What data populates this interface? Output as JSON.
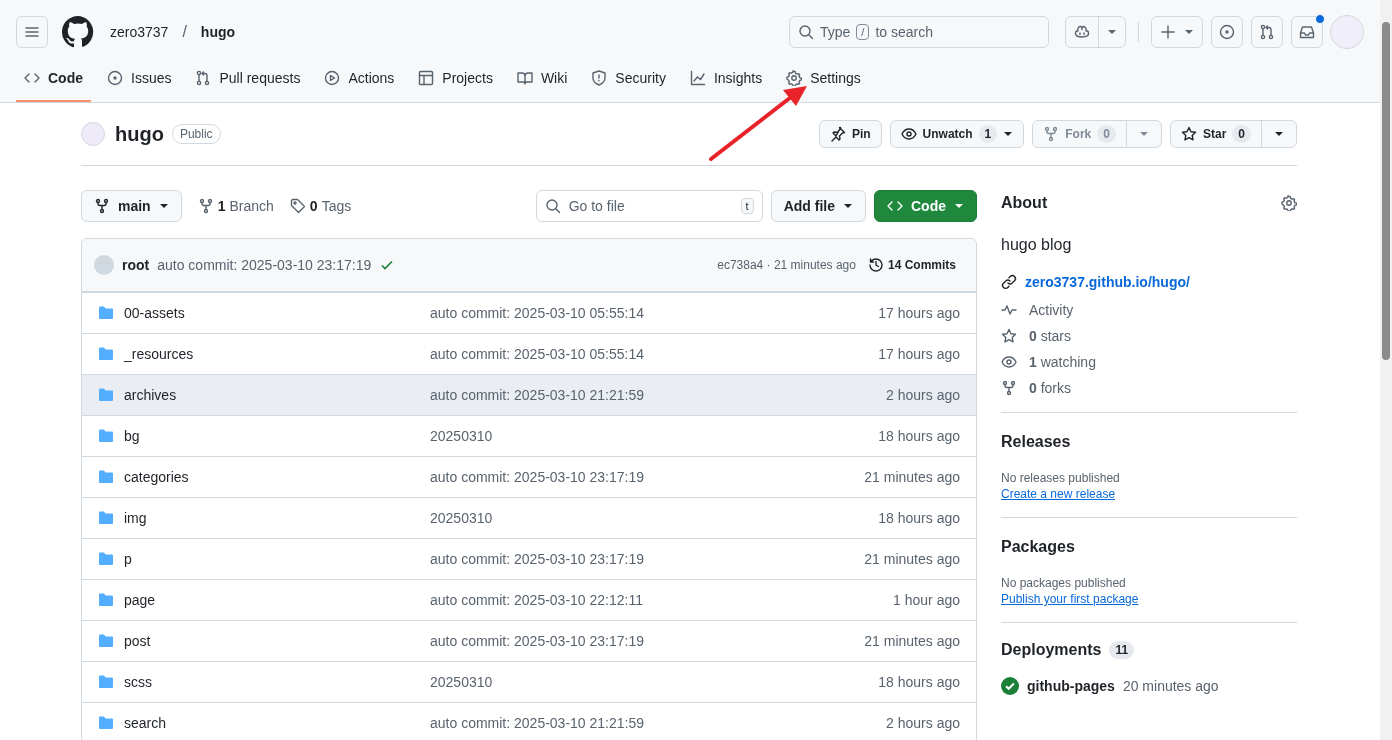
{
  "header": {
    "owner": "zero3737",
    "separator": "/",
    "repo": "hugo",
    "search": {
      "placeholder_before": "Type",
      "key": "/",
      "placeholder_after": "to search"
    },
    "notification_dot": true
  },
  "tabs": [
    {
      "label": "Code",
      "selected": true
    },
    {
      "label": "Issues",
      "selected": false
    },
    {
      "label": "Pull requests",
      "selected": false
    },
    {
      "label": "Actions",
      "selected": false
    },
    {
      "label": "Projects",
      "selected": false
    },
    {
      "label": "Wiki",
      "selected": false
    },
    {
      "label": "Security",
      "selected": false
    },
    {
      "label": "Insights",
      "selected": false
    },
    {
      "label": "Settings",
      "selected": false
    }
  ],
  "repo": {
    "name": "hugo",
    "visibility": "Public",
    "actions": [
      {
        "label": "Pin",
        "disabled": false
      },
      {
        "label": "Unwatch",
        "count": "1",
        "disabled": false
      },
      {
        "label": "Fork",
        "count": "0",
        "disabled": true
      },
      {
        "label": "Star",
        "count": "0",
        "disabled": false
      }
    ]
  },
  "toolbar": {
    "branch": "main",
    "branches": {
      "count": "1",
      "label": "Branch"
    },
    "tags": {
      "count": "0",
      "label": "Tags"
    },
    "go_to_file": {
      "placeholder": "Go to file",
      "key": "t"
    },
    "add_file": "Add file",
    "code": "Code"
  },
  "latest_commit": {
    "author": "root",
    "message": "auto commit: 2025-03-10 23:17:19",
    "hash_time": "ec738a4 · 21 minutes ago",
    "commits": "14 Commits"
  },
  "files": [
    {
      "name": "00-assets",
      "message": "auto commit: 2025-03-10 05:55:14",
      "time": "17 hours ago",
      "hovered": false
    },
    {
      "name": "_resources",
      "message": "auto commit: 2025-03-10 05:55:14",
      "time": "17 hours ago",
      "hovered": false
    },
    {
      "name": "archives",
      "message": "auto commit: 2025-03-10 21:21:59",
      "time": "2 hours ago",
      "hovered": true
    },
    {
      "name": "bg",
      "message": "20250310",
      "time": "18 hours ago",
      "hovered": false
    },
    {
      "name": "categories",
      "message": "auto commit: 2025-03-10 23:17:19",
      "time": "21 minutes ago",
      "hovered": false
    },
    {
      "name": "img",
      "message": "20250310",
      "time": "18 hours ago",
      "hovered": false
    },
    {
      "name": "p",
      "message": "auto commit: 2025-03-10 23:17:19",
      "time": "21 minutes ago",
      "hovered": false
    },
    {
      "name": "page",
      "message": "auto commit: 2025-03-10 22:12:11",
      "time": "1 hour ago",
      "hovered": false
    },
    {
      "name": "post",
      "message": "auto commit: 2025-03-10 23:17:19",
      "time": "21 minutes ago",
      "hovered": false
    },
    {
      "name": "scss",
      "message": "20250310",
      "time": "18 hours ago",
      "hovered": false
    },
    {
      "name": "search",
      "message": "auto commit: 2025-03-10 21:21:59",
      "time": "2 hours ago",
      "hovered": false
    }
  ],
  "about": {
    "title": "About",
    "description": "hugo blog",
    "website": "zero3737.github.io/hugo/",
    "stats": [
      "Activity",
      "**0** stars",
      "**1** watching",
      "**0** forks"
    ]
  },
  "releases": {
    "title": "Releases",
    "note": "No releases published",
    "link": "Create a new release"
  },
  "packages": {
    "title": "Packages",
    "note": "No packages published",
    "link": "Publish your first package"
  },
  "deployments": {
    "title": "Deployments",
    "count": "11",
    "items": [
      {
        "name": "github-pages",
        "time": "20 minutes ago"
      }
    ]
  }
}
